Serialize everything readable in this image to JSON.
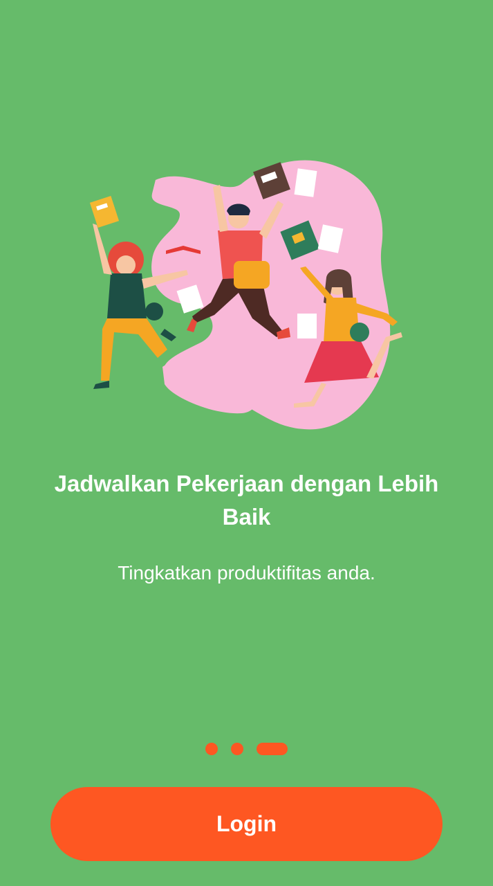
{
  "onboarding": {
    "title": "Jadwalkan Pekerjaan dengan Lebih Baik",
    "subtitle": "Tingkatkan produktifitas anda.",
    "login_label": "Login",
    "page_indicator": {
      "total": 3,
      "active_index": 3
    }
  },
  "colors": {
    "background": "#66bb6a",
    "accent": "#fe5722",
    "blob": "#f9b8d8",
    "text": "#ffffff"
  },
  "icons": [
    "students-celebrating-illustration"
  ]
}
